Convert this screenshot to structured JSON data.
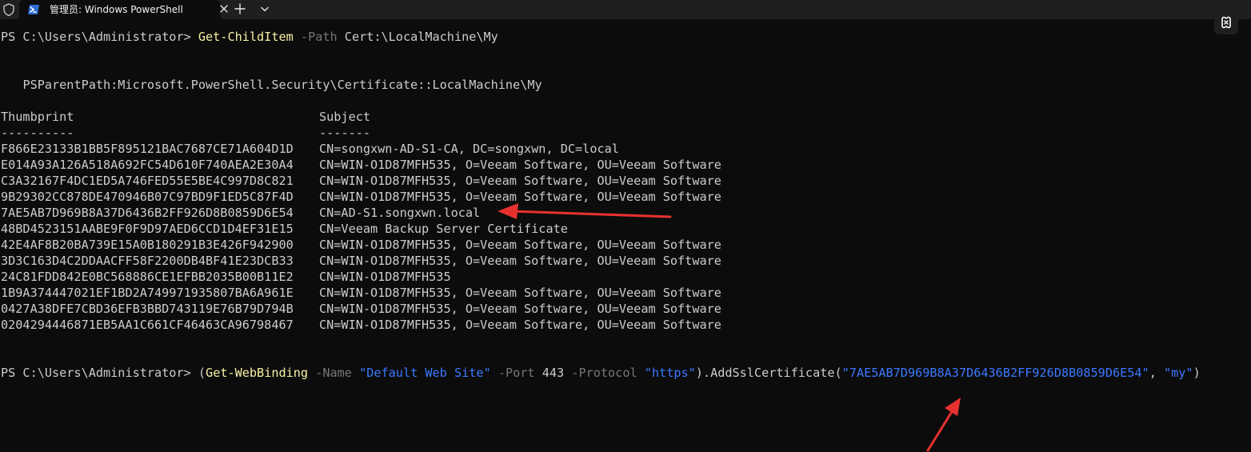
{
  "window": {
    "tab_title": "管理员: Windows PowerShell",
    "tab_icon": "powershell-icon",
    "close_icon": "close-icon",
    "new_tab_icon": "plus-icon",
    "dropdown_icon": "chevron-down-icon",
    "shield_icon": "shield-icon",
    "copilot_icon": "copilot-icon"
  },
  "terminal": {
    "cmd1": {
      "prompt": "PS C:\\Users\\Administrator> ",
      "cmdlet": "Get-ChildItem",
      "param": "-Path",
      "arg": "Cert:\\LocalMachine\\My"
    },
    "ps_parent_path": "PSParentPath:Microsoft.PowerShell.Security\\Certificate::LocalMachine\\My",
    "table": {
      "headers": [
        "Thumbprint",
        "Subject"
      ],
      "separators": [
        "----------",
        "-------"
      ],
      "rows": [
        {
          "thumbprint": "F866E23133B1BB5F895121BAC7687CE71A604D1D",
          "subject": "CN=songxwn-AD-S1-CA, DC=songxwn, DC=local"
        },
        {
          "thumbprint": "E014A93A126A518A692FC54D610F740AEA2E30A4",
          "subject": "CN=WIN-O1D87MFH535, O=Veeam Software, OU=Veeam Software"
        },
        {
          "thumbprint": "C3A32167F4DC1ED5A746FED55E5BE4C997D8C821",
          "subject": "CN=WIN-O1D87MFH535, O=Veeam Software, OU=Veeam Software"
        },
        {
          "thumbprint": "9B29302CC878DE470946B07C97BD9F1ED5C87F4D",
          "subject": "CN=WIN-O1D87MFH535, O=Veeam Software, OU=Veeam Software"
        },
        {
          "thumbprint": "7AE5AB7D969B8A37D6436B2FF926D8B0859D6E54",
          "subject": "CN=AD-S1.songxwn.local"
        },
        {
          "thumbprint": "48BD4523151AABE9F0F9D97AED6CCD1D4EF31E15",
          "subject": "CN=Veeam Backup Server Certificate"
        },
        {
          "thumbprint": "42E4AF8B20BA739E15A0B180291B3E426F942900",
          "subject": "CN=WIN-O1D87MFH535, O=Veeam Software, OU=Veeam Software"
        },
        {
          "thumbprint": "3D3C163D4C2DDAACFF58F2200DB4BF41E23DCB33",
          "subject": "CN=WIN-O1D87MFH535, O=Veeam Software, OU=Veeam Software"
        },
        {
          "thumbprint": "24C81FDD842E0BC568886CE1EFBB2035B00B11E2",
          "subject": "CN=WIN-O1D87MFH535"
        },
        {
          "thumbprint": "1B9A374447021EF1BD2A749971935807BA6A961E",
          "subject": "CN=WIN-O1D87MFH535, O=Veeam Software, OU=Veeam Software"
        },
        {
          "thumbprint": "0427A38DFE7CBD36EFB3BBD743119E76B79D794B",
          "subject": "CN=WIN-O1D87MFH535, O=Veeam Software, OU=Veeam Software"
        },
        {
          "thumbprint": "0204294446871EB5AA1C661CF46463CA96798467",
          "subject": "CN=WIN-O1D87MFH535, O=Veeam Software, OU=Veeam Software"
        }
      ]
    },
    "cmd2": {
      "prompt": "PS C:\\Users\\Administrator> ",
      "open_paren": "(",
      "cmdlet": "Get-WebBinding",
      "p_name": "-Name",
      "v_name": "\"Default Web Site\"",
      "p_port": "-Port",
      "v_port": "443",
      "p_protocol": "-Protocol",
      "v_protocol": "\"https\"",
      "method": ").AddSslCertificate(",
      "v_thumb": "\"7AE5AB7D969B8A37D6436B2FF926D8B0859D6E54\"",
      "comma": ", ",
      "v_store": "\"my\"",
      "close_paren": ")"
    }
  },
  "colors": {
    "background": "#0c0c0c",
    "foreground": "#cccccc",
    "cmdlet": "#f9f1a5",
    "parameter": "#767676",
    "string": "#3b78ff",
    "annotation_arrow": "#e8312f"
  }
}
